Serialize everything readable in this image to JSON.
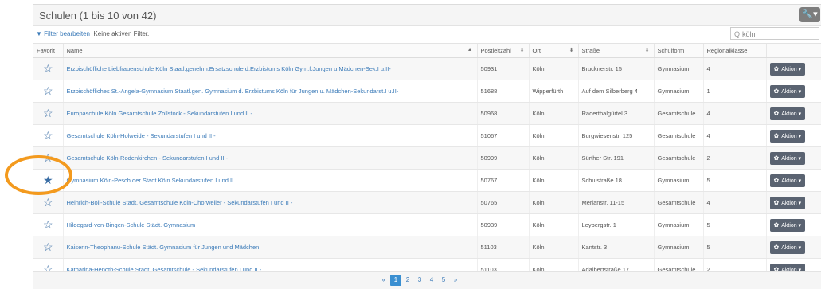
{
  "panel": {
    "title": "Schulen (1 bis 10 von 42)"
  },
  "filter": {
    "edit_label": "Filter bearbeiten",
    "status": "Keine aktiven Filter."
  },
  "search": {
    "value": "köln"
  },
  "columns": [
    "Favorit",
    "Name",
    "Postleitzahl",
    "Ort",
    "Straße",
    "Schulform",
    "Regionalklasse",
    ""
  ],
  "rows": [
    {
      "fav": "☆",
      "name": "Erzbischöfliche Liebfrauenschule Köln Staatl.genehm.Ersatzschule d.Erzbistums Köln Gym.f.Jungen u.Mädchen-Sek.I u.II-",
      "plz": "50931",
      "ort": "Köln",
      "str": "Brucknerstr. 15",
      "form": "Gymnasium",
      "rk": "4",
      "action": "Aktion"
    },
    {
      "fav": "☆",
      "name": "Erzbischöfliches St.-Angela-Gymnasium Staatl.gen. Gymnasium d. Erzbistums Köln für Jungen u. Mädchen-Sekundarst.I u.II-",
      "plz": "51688",
      "ort": "Wipperfürth",
      "str": "Auf dem Silberberg 4",
      "form": "Gymnasium",
      "rk": "1",
      "action": "Aktion"
    },
    {
      "fav": "☆",
      "name": "Europaschule Köln Gesamtschule Zollstock - Sekundarstufen I und II -",
      "plz": "50968",
      "ort": "Köln",
      "str": "Raderthalgürtel 3",
      "form": "Gesamtschule",
      "rk": "4",
      "action": "Aktion"
    },
    {
      "fav": "☆",
      "name": "Gesamtschule Köln-Holweide - Sekundarstufen I und II -",
      "plz": "51067",
      "ort": "Köln",
      "str": "Burgwiesenstr. 125",
      "form": "Gesamtschule",
      "rk": "4",
      "action": "Aktion"
    },
    {
      "fav": "☆",
      "name": "Gesamtschule Köln-Rodenkirchen - Sekundarstufen I und II -",
      "plz": "50999",
      "ort": "Köln",
      "str": "Sürther Str. 191",
      "form": "Gesamtschule",
      "rk": "2",
      "action": "Aktion"
    },
    {
      "fav": "★",
      "name": "Gymnasium Köln-Pesch der Stadt Köln Sekundarstufen I und II",
      "plz": "50767",
      "ort": "Köln",
      "str": "Schulstraße 18",
      "form": "Gymnasium",
      "rk": "5",
      "action": "Aktion"
    },
    {
      "fav": "☆",
      "name": "Heinrich-Böll-Schule Städt. Gesamtschule Köln-Chorweiler - Sekundarstufen I und II -",
      "plz": "50765",
      "ort": "Köln",
      "str": "Merianstr. 11-15",
      "form": "Gesamtschule",
      "rk": "4",
      "action": "Aktion"
    },
    {
      "fav": "☆",
      "name": "Hildegard-von-Bingen-Schule Städt. Gymnasium",
      "plz": "50939",
      "ort": "Köln",
      "str": "Leybergstr. 1",
      "form": "Gymnasium",
      "rk": "5",
      "action": "Aktion"
    },
    {
      "fav": "☆",
      "name": "Kaiserin-Theophanu-Schule Städt. Gymnasium für Jungen und Mädchen",
      "plz": "51103",
      "ort": "Köln",
      "str": "Kantstr. 3",
      "form": "Gymnasium",
      "rk": "5",
      "action": "Aktion"
    },
    {
      "fav": "☆",
      "name": "Katharina-Henoth-Schule Städt. Gesamtschule - Sekundarstufen I und II -",
      "plz": "51103",
      "ort": "Köln",
      "str": "Adalbertstraße 17",
      "form": "Gesamtschule",
      "rk": "2",
      "action": "Aktion"
    }
  ],
  "pagination": {
    "prev": "«",
    "pages": [
      "1",
      "2",
      "3",
      "4",
      "5"
    ],
    "next": "»",
    "active": "1"
  },
  "colors": {
    "link": "#3a7ab8",
    "active_page": "#3a8fd1",
    "button": "#5a6371",
    "highlight": "#f39a1e"
  }
}
